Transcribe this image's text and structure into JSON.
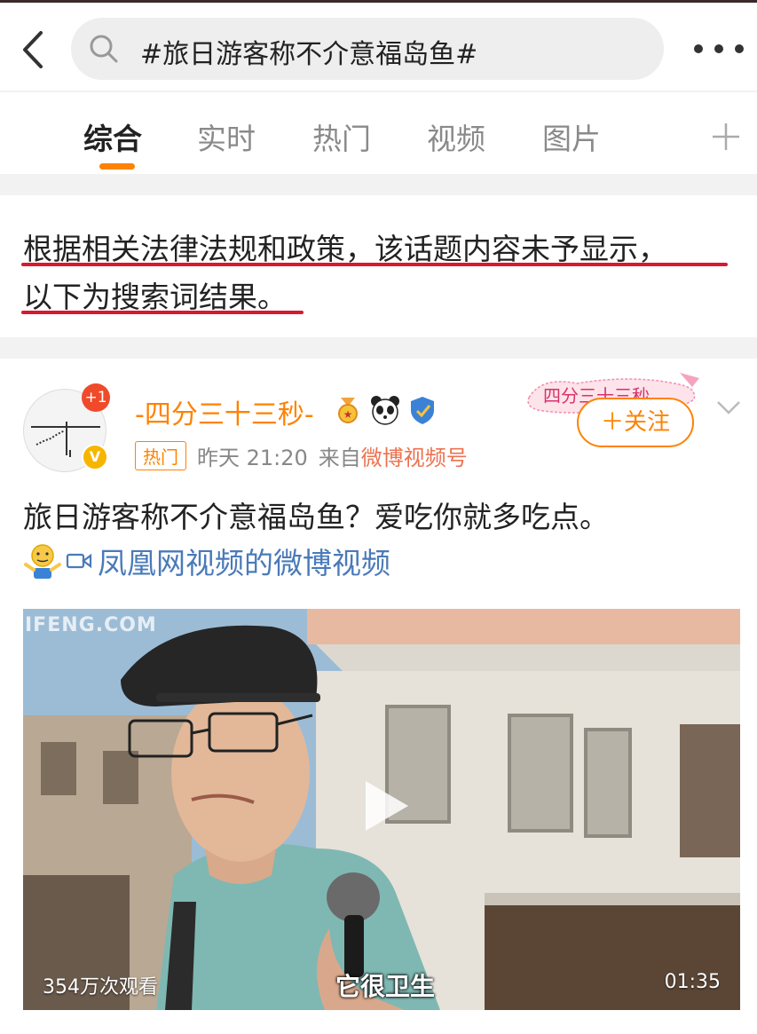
{
  "search": {
    "query": "#旅日游客称不介意福岛鱼#"
  },
  "tabs": [
    {
      "label": "综合",
      "active": true
    },
    {
      "label": "实时"
    },
    {
      "label": "热门"
    },
    {
      "label": "视频"
    },
    {
      "label": "图片"
    }
  ],
  "notice": {
    "line1": "根据相关法律法规和政策，该话题内容未予显示，",
    "line2": "以下为搜索词结果。"
  },
  "post": {
    "avatar_badge": "+1",
    "verified_badge": "V",
    "username": "-四分三十三秒-",
    "stamp_text": "四分三十三秒",
    "hot_tag": "热门",
    "time": "昨天 21:20",
    "source_prefix": "来自",
    "source_name": "微博视频号",
    "follow_label": "＋关注",
    "text": "旅日游客称不介意福岛鱼？爱吃你就多吃点。",
    "video_link": "凤凰网视频的微博视频",
    "video": {
      "views": "354万次观看",
      "duration": "01:35",
      "subtitle": "它很卫生",
      "watermark": "IFENG.COM"
    }
  },
  "colors": {
    "accent": "#ff8200",
    "link": "#4a7ab8",
    "underline": "#d8192e"
  }
}
